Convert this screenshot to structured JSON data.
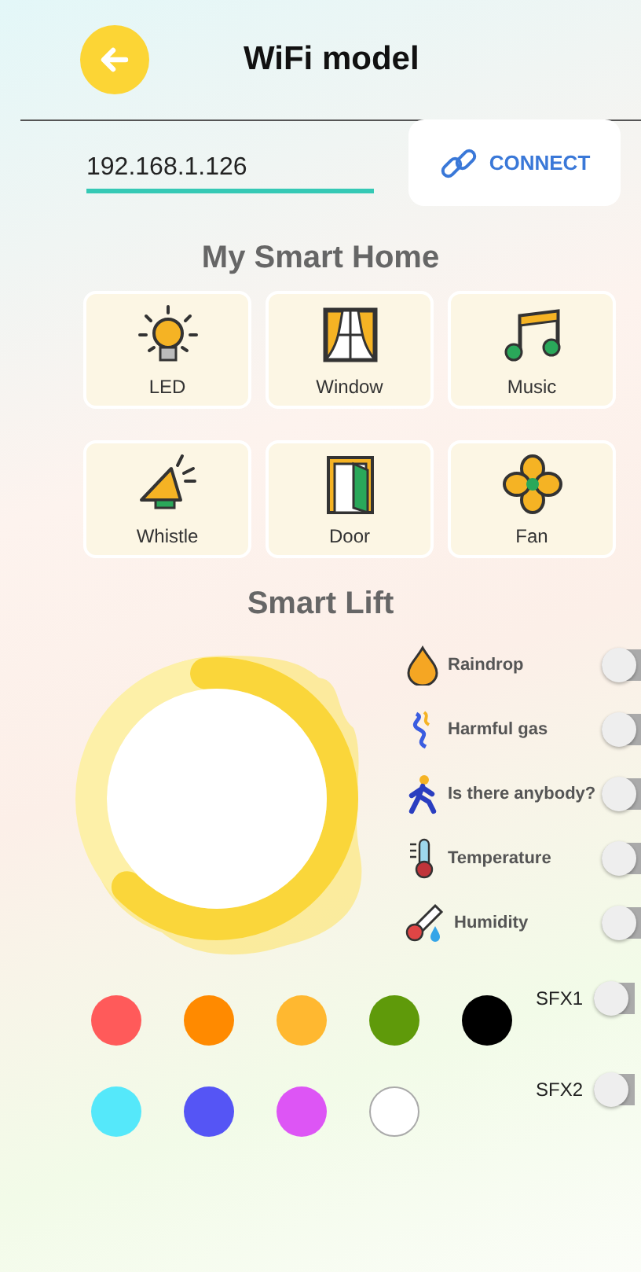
{
  "header": {
    "title": "WiFi model"
  },
  "connection": {
    "address": "192.168.1.126",
    "button": "CONNECT"
  },
  "smart_home": {
    "title": "My Smart Home",
    "devices": [
      {
        "label": "LED",
        "kind": "bulb"
      },
      {
        "label": "Window",
        "kind": "window"
      },
      {
        "label": "Music",
        "kind": "music"
      },
      {
        "label": "Whistle",
        "kind": "horn"
      },
      {
        "label": "Door",
        "kind": "door"
      },
      {
        "label": "Fan",
        "kind": "fan"
      }
    ]
  },
  "smart_lift": {
    "title": "Smart Lift",
    "level": 0.64,
    "sensors": [
      {
        "label": "Raindrop",
        "kind": "drop",
        "on": false
      },
      {
        "label": "Harmful gas",
        "kind": "gas",
        "on": false
      },
      {
        "label": "Is there anybody?",
        "kind": "person",
        "on": false
      },
      {
        "label": "Temperature",
        "kind": "thermo",
        "on": false
      },
      {
        "label": "Humidity",
        "kind": "humidity",
        "on": false
      }
    ]
  },
  "colors": [
    {
      "color": "#ff5a5a"
    },
    {
      "color": "#ff8a00"
    },
    {
      "color": "#ffb830"
    },
    {
      "color": "#5f9a0a"
    },
    {
      "color": "#000000"
    },
    {
      "color": "#55e8fa"
    },
    {
      "color": "#5555f5"
    },
    {
      "color": "#dd55f5"
    },
    {
      "color": "#ffffff"
    }
  ],
  "effects": [
    {
      "label": "SFX1",
      "on": false
    },
    {
      "label": "SFX2",
      "on": false
    }
  ]
}
